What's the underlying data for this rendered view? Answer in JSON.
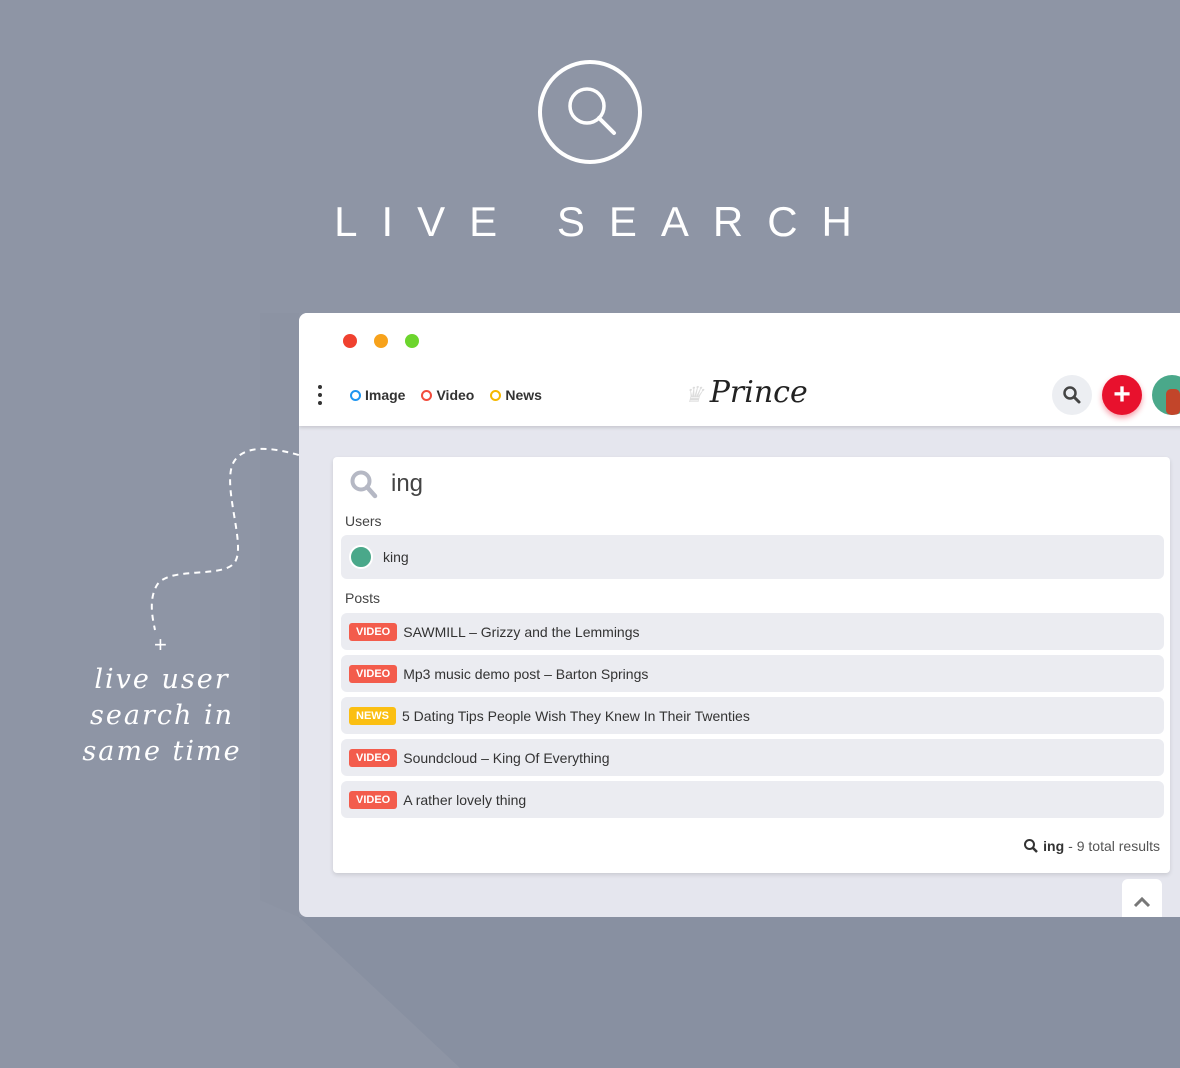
{
  "hero": {
    "title": "LIVE SEARCH",
    "icon": "search-icon"
  },
  "note": {
    "lines": [
      "live user",
      "search in",
      "same time"
    ],
    "plus": "+"
  },
  "window": {
    "controls": {
      "close": "#f0412f",
      "minimize": "#f7a21b",
      "maximize": "#6cd52d"
    }
  },
  "toolbar": {
    "filters": [
      {
        "label": "Image",
        "color": "#1e95f0"
      },
      {
        "label": "Video",
        "color": "#f24c3d"
      },
      {
        "label": "News",
        "color": "#f5b800"
      }
    ],
    "logo": "Prince",
    "add_label": "+",
    "accent": "#e8112d"
  },
  "search": {
    "query": "ing",
    "users_label": "Users",
    "posts_label": "Posts",
    "users": [
      {
        "name": "king"
      }
    ],
    "posts": [
      {
        "badge": "VIDEO",
        "title": "SAWMILL – Grizzy and the Lemmings"
      },
      {
        "badge": "VIDEO",
        "title": "Mp3 music demo post – Barton Springs"
      },
      {
        "badge": "NEWS",
        "title": "5 Dating Tips People Wish They Knew In Their Twenties"
      },
      {
        "badge": "VIDEO",
        "title": "Soundcloud – King Of Everything"
      },
      {
        "badge": "VIDEO",
        "title": "A rather lovely thing"
      }
    ],
    "badge_colors": {
      "VIDEO": "#f35c4c",
      "NEWS": "#fbbf12"
    },
    "total_query": "ing",
    "total_text": "- 9 total results"
  }
}
